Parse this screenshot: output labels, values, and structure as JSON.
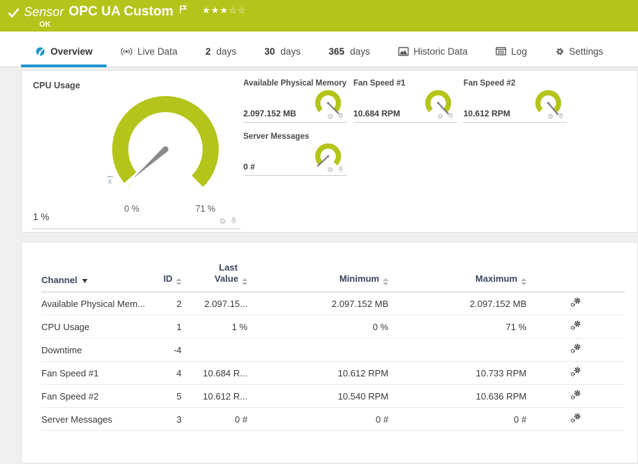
{
  "colors": {
    "brand_green": "#b4c41a",
    "accent_blue": "#2196ce"
  },
  "header": {
    "kind_label": "Sensor",
    "sensor_name": "OPC UA Custom",
    "status": "OK",
    "stars_filled": "★★★",
    "stars_empty": "☆☆"
  },
  "tabs": {
    "overview": "Overview",
    "live_data": "Live Data",
    "d2_num": "2",
    "d2_unit": "days",
    "d30_num": "30",
    "d30_unit": "days",
    "d365_num": "365",
    "d365_unit": "days",
    "historic": "Historic Data",
    "log": "Log",
    "settings": "Settings"
  },
  "gauges": {
    "cpu": {
      "title": "CPU Usage",
      "value": "1 %",
      "scale_min": "0 %",
      "scale_max": "71 %",
      "avg_marker": "x"
    },
    "small": [
      {
        "title": "Available Physical Memory",
        "value": "2.097.152 MB"
      },
      {
        "title": "Fan Speed #1",
        "value": "10.684 RPM"
      },
      {
        "title": "Fan Speed #2",
        "value": "10.612 RPM"
      },
      {
        "title": "Server Messages",
        "value": "0 #"
      }
    ]
  },
  "channel_table": {
    "headers": {
      "channel": "Channel",
      "id": "ID",
      "last_line1": "Last",
      "last_line2": "Value",
      "minimum": "Minimum",
      "maximum": "Maximum"
    },
    "rows": [
      {
        "channel": "Available Physical Mem...",
        "id": "2",
        "last": "2.097.15...",
        "min": "2.097.152 MB",
        "max": "2.097.152 MB"
      },
      {
        "channel": "CPU Usage",
        "id": "1",
        "last": "1 %",
        "min": "0 %",
        "max": "71 %"
      },
      {
        "channel": "Downtime",
        "id": "-4",
        "last": "",
        "min": "",
        "max": ""
      },
      {
        "channel": "Fan Speed #1",
        "id": "4",
        "last": "10.684 R...",
        "min": "10.612 RPM",
        "max": "10.733 RPM"
      },
      {
        "channel": "Fan Speed #2",
        "id": "5",
        "last": "10.612 R...",
        "min": "10.540 RPM",
        "max": "10.636 RPM"
      },
      {
        "channel": "Server Messages",
        "id": "3",
        "last": "0 #",
        "min": "0 #",
        "max": "0 #"
      }
    ]
  }
}
